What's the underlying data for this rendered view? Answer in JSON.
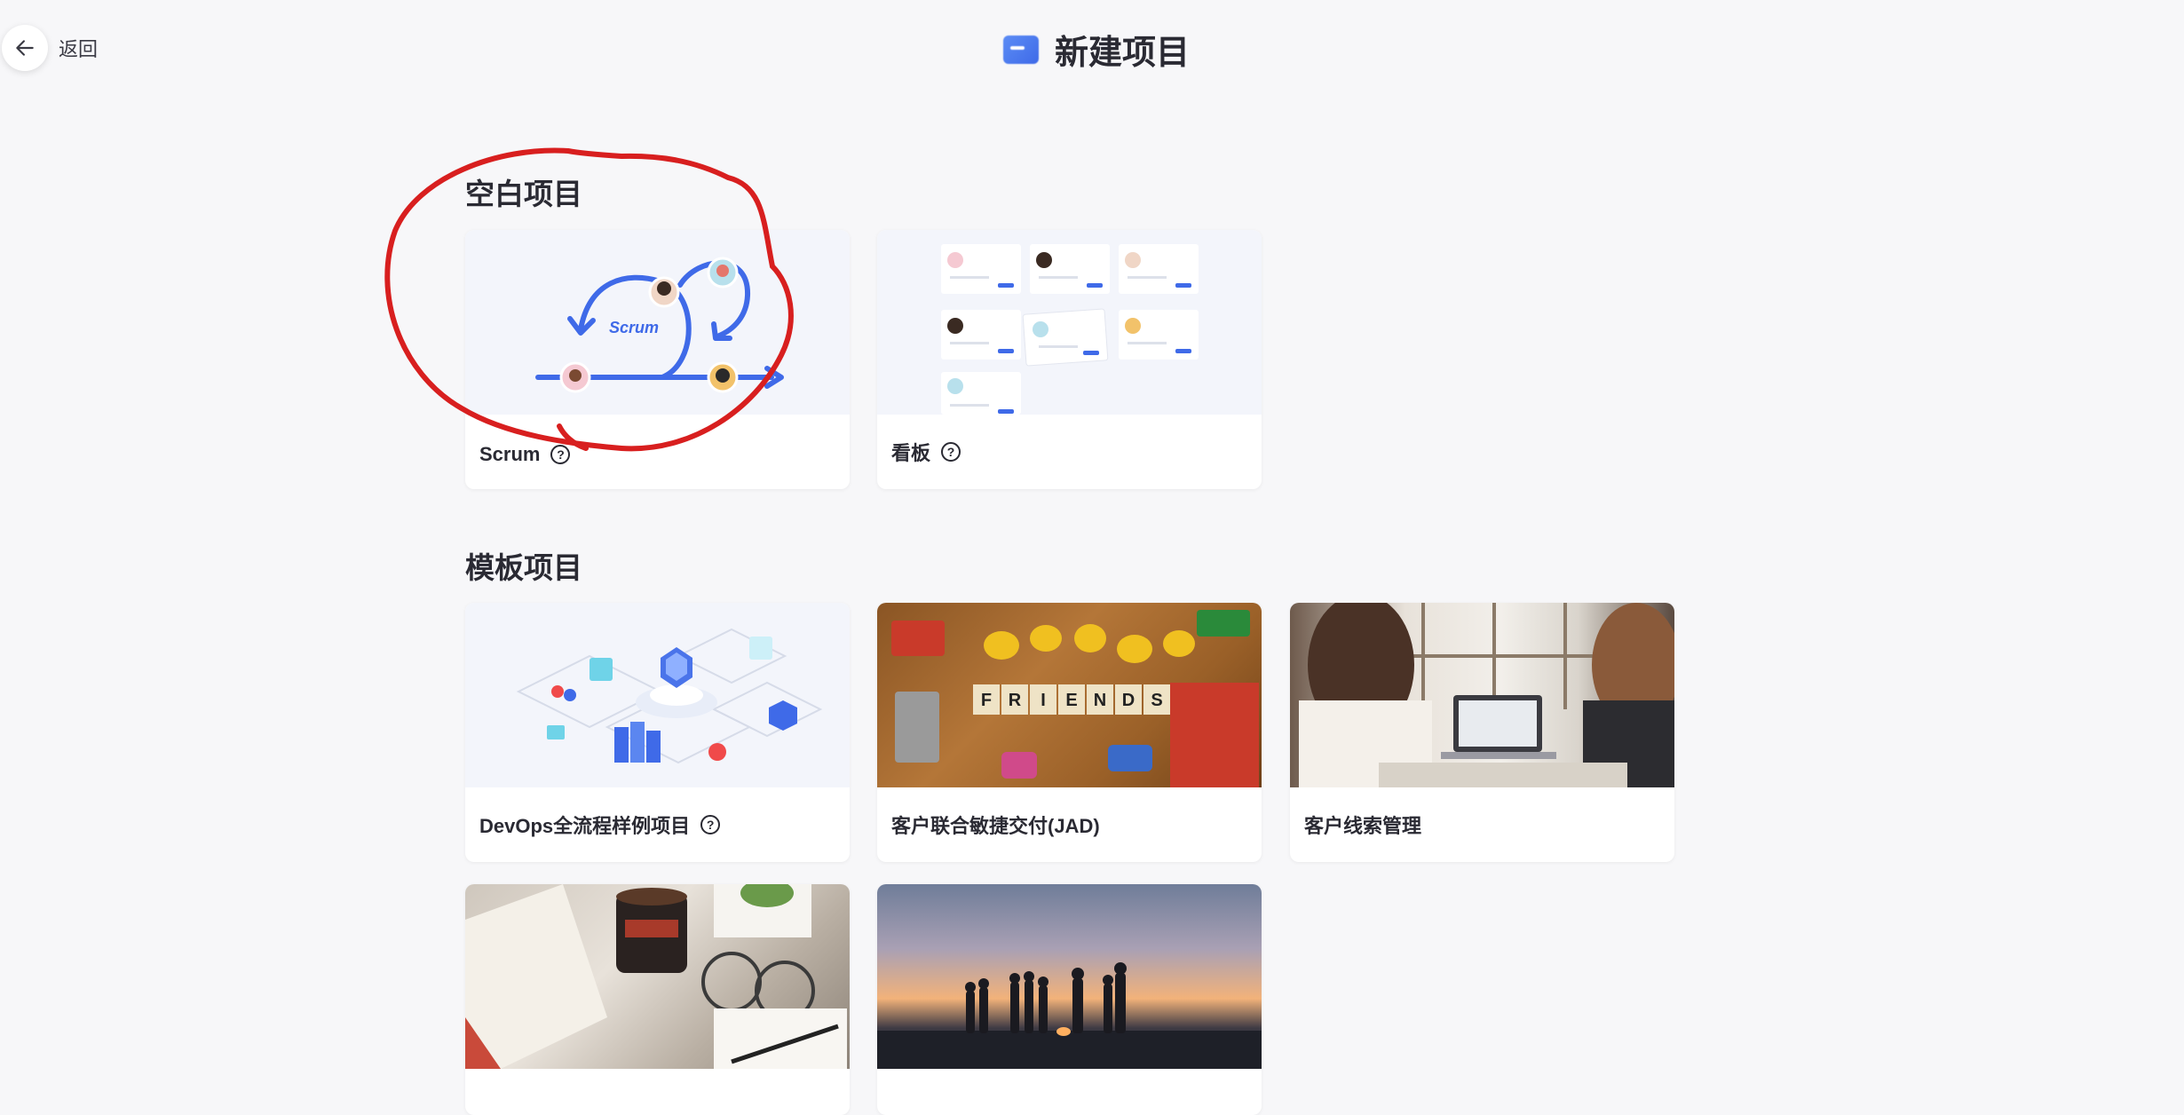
{
  "header": {
    "back_label": "返回",
    "title": "新建项目"
  },
  "sections": {
    "blank": {
      "title": "空白项目",
      "cards": [
        {
          "label": "Scrum",
          "has_help": true,
          "illustration_text": "Scrum"
        },
        {
          "label": "看板",
          "has_help": true
        }
      ]
    },
    "template": {
      "title": "模板项目",
      "cards": [
        {
          "label": "DevOps全流程样例项目",
          "has_help": true
        },
        {
          "label": "客户联合敏捷交付(JAD)",
          "has_help": false
        },
        {
          "label": "客户线索管理",
          "has_help": false
        },
        {
          "label": "",
          "has_help": false
        },
        {
          "label": "",
          "has_help": false
        }
      ]
    }
  },
  "friends_letters": [
    "F",
    "R",
    "I",
    "E",
    "N",
    "D",
    "S"
  ],
  "help_glyph": "?",
  "colors": {
    "accent": "#3f6ae8",
    "annotation_red": "#d81f1f",
    "background": "#f7f7f9"
  },
  "icons": {
    "back": "arrow-left-icon",
    "help": "question-circle-icon"
  }
}
